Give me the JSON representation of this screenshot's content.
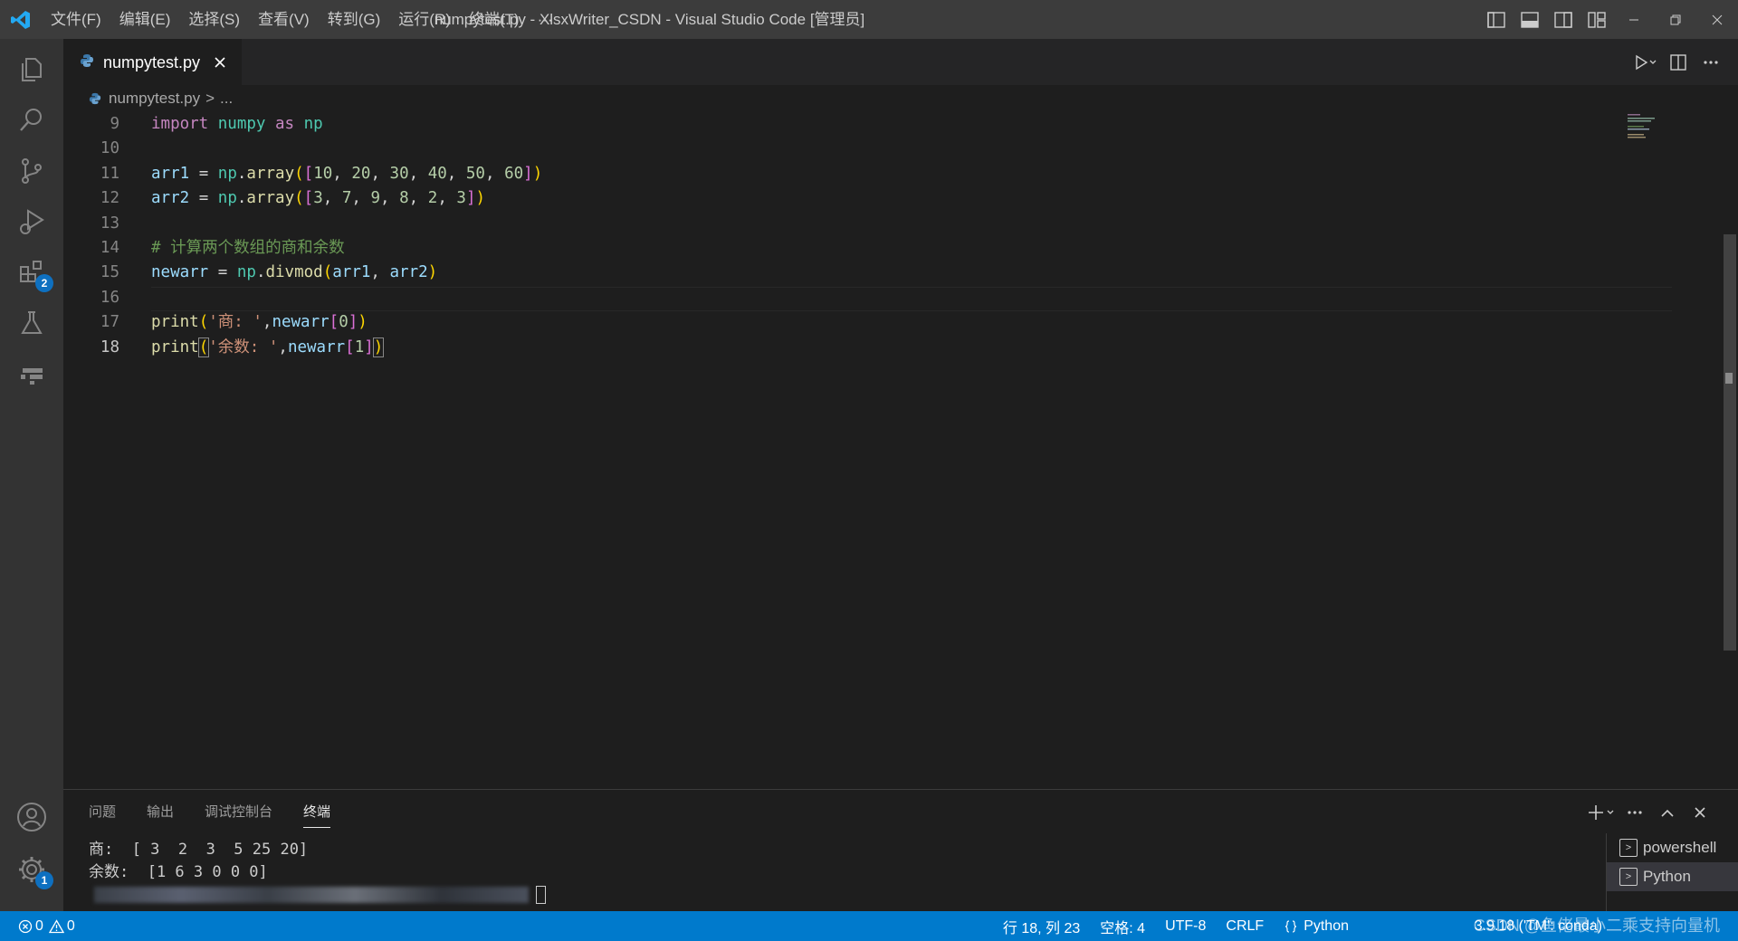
{
  "titlebar": {
    "menu": [
      "文件(F)",
      "编辑(E)",
      "选择(S)",
      "查看(V)",
      "转到(G)",
      "运行(R)",
      "终端(T)",
      "···"
    ],
    "title": "numpytest.py - XlsxWriter_CSDN - Visual Studio Code [管理员]"
  },
  "activity_bar": {
    "extensions_badge": "2",
    "settings_badge": "1"
  },
  "tabs": [
    {
      "label": "numpytest.py",
      "active": true
    }
  ],
  "breadcrumb": {
    "file": "numpytest.py",
    "separator": ">",
    "rest": "..."
  },
  "editor": {
    "current_line": 18,
    "line_numbers": [
      "9",
      "10",
      "11",
      "12",
      "13",
      "14",
      "15",
      "16",
      "17",
      "18"
    ],
    "lines": [
      "import numpy as np",
      "",
      "arr1 = np.array([10, 20, 30, 40, 50, 60])",
      "arr2 = np.array([3, 7, 9, 8, 2, 3])",
      "",
      "# 计算两个数组的商和余数",
      "newarr = np.divmod(arr1, arr2)",
      "",
      "print('商: ',newarr[0])",
      "print('余数: ',newarr[1])"
    ]
  },
  "panel": {
    "tabs": [
      "问题",
      "输出",
      "调试控制台",
      "终端"
    ],
    "active_tab": "终端",
    "terminal_lines": [
      "商:  [ 3  2  3  5 25 20]",
      "余数:  [1 6 3 0 0 0]"
    ],
    "terminals": [
      "powershell",
      "Python"
    ]
  },
  "statusbar": {
    "errors": "0",
    "warnings": "0",
    "position": "行 18, 列 23",
    "spaces": "空格: 4",
    "encoding": "UTF-8",
    "eol": "CRLF",
    "language": "Python",
    "interpreter": "3.9.18 ('TM': conda)",
    "watermark": "CSDN @鱼佬最小二乘支持向量机"
  },
  "colors": {
    "statusbar": "#007acc",
    "titlebar": "#3c3c3c",
    "activitybar": "#333333",
    "editor": "#1e1e1e"
  }
}
